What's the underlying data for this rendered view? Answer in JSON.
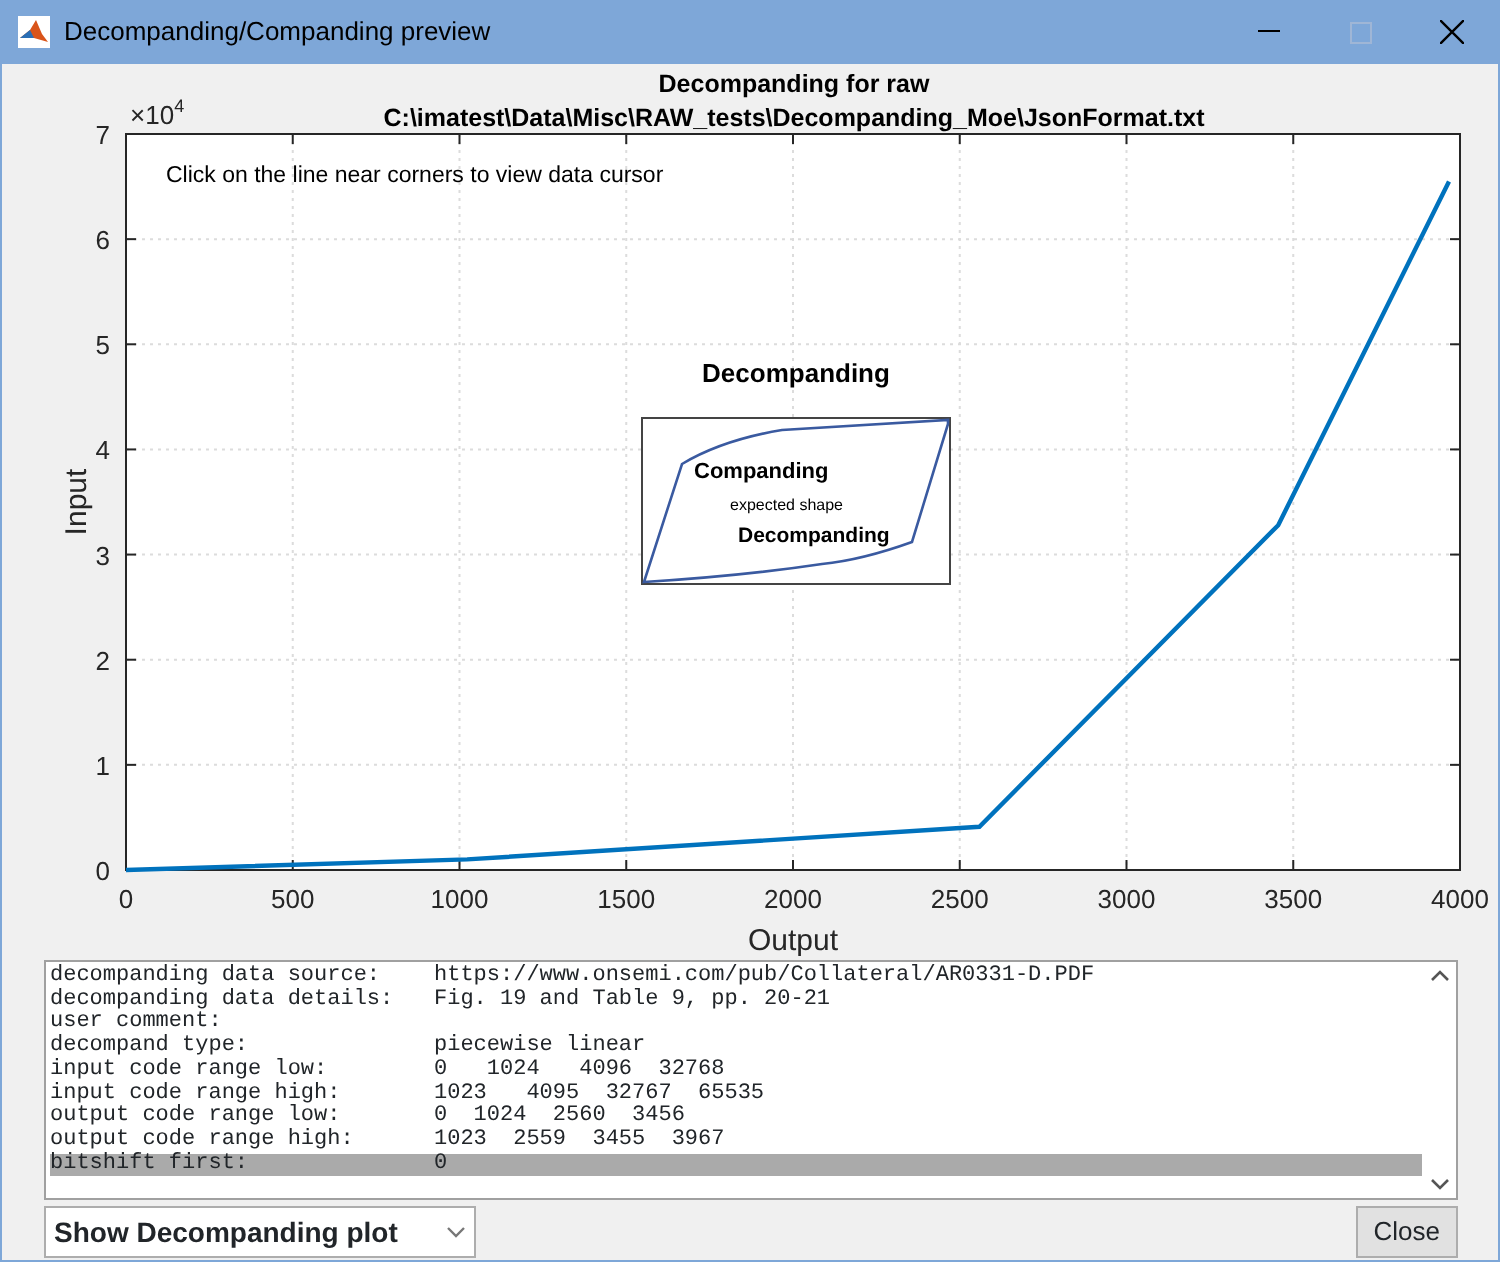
{
  "window": {
    "title": "Decompanding/Companding preview"
  },
  "plot": {
    "title": "Decompanding for raw",
    "file_path": "C:\\imatest\\Data\\Misc\\RAW_tests\\Decompanding_Moe\\JsonFormat.txt",
    "hint": "Click on the line near corners to view data cursor",
    "y_multiplier": "×10",
    "y_exponent": "4",
    "inset": {
      "heading": "Decompanding",
      "labels": [
        "Companding",
        "expected shape",
        "Decompanding"
      ]
    },
    "chart_data": {
      "type": "line",
      "xlabel": "Output",
      "ylabel": "Input",
      "x": [
        0,
        1023,
        2559,
        3455,
        3967
      ],
      "series": [
        {
          "color": "#0072bd",
          "values": [
            0,
            0.1,
            0.41,
            3.28,
            6.55
          ]
        }
      ],
      "xlim": [
        0,
        4000
      ],
      "ylim": [
        0,
        7
      ],
      "xticks": [
        0,
        500,
        1000,
        1500,
        2000,
        2500,
        3000,
        3500,
        4000
      ],
      "yticks": [
        0,
        1,
        2,
        3,
        4,
        5,
        6,
        7
      ]
    }
  },
  "output_lines": [
    {
      "label": "decompanding data source:",
      "value": "https://www.onsemi.com/pub/Collateral/AR0331-D.PDF",
      "selected": false
    },
    {
      "label": "decompanding data details:",
      "value": "Fig. 19 and Table 9, pp. 20-21",
      "selected": false
    },
    {
      "label": "user comment:",
      "selected": false
    },
    {
      "label": "decompand type:",
      "value": "piecewise linear",
      "selected": false
    },
    {
      "label": "input code range low:",
      "value": "0   1024   4096  32768",
      "selected": false
    },
    {
      "label": "input code range high:",
      "value": "1023   4095  32767  65535",
      "selected": false
    },
    {
      "label": "output code range low:",
      "value": "0  1024  2560  3456",
      "selected": false
    },
    {
      "label": "output code range high:",
      "value": "1023  2559  3455  3967",
      "selected": false
    },
    {
      "label": "bitshift first:",
      "value": "0",
      "selected": true
    }
  ],
  "plot_selector": {
    "value": "Show Decompanding plot"
  },
  "buttons": [
    "Close"
  ]
}
